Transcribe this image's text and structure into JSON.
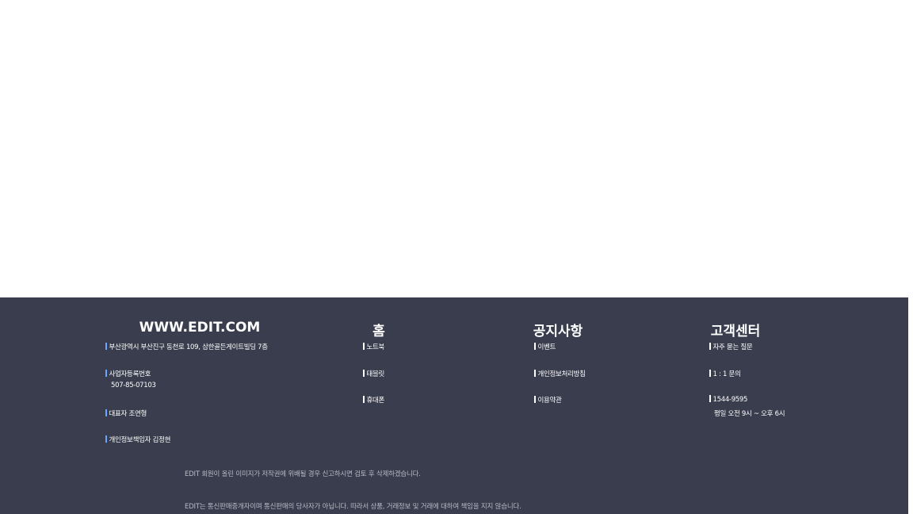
{
  "footer": {
    "col1": {
      "title": "WWW.EDIT.COM",
      "address": "부산광역시 부산진구 동천로 109, 삼한골든게이트빌딩 7층",
      "biz_label": "사업자등록번호",
      "biz_number": "507-85-07103",
      "ceo": "대표자 조연형",
      "privacy_officer": "개인정보책임자 김정현"
    },
    "col2": {
      "title": "홈",
      "items": [
        "노트북",
        "태블릿",
        "휴대폰"
      ]
    },
    "col3": {
      "title": "공지사항",
      "items": [
        "이벤트",
        "개인정보처리방침",
        "이용약관"
      ]
    },
    "col4": {
      "title": "고객센터",
      "faq": "자주 묻는 질문",
      "inquiry": "1 : 1 문의",
      "phone": "1544-9595",
      "hours": "평일 오전 9시 ~ 오후 6시"
    },
    "notice1": "EDIT 회원이 올린 이미지가 저작권에 위배될 경우 신고하시면 검토 후 삭제하겠습니다.",
    "notice2": "EDIT는 통신판매중개자이며 통신판매의 당사자가 아닙니다. 따라서 상품, 거래정보 및 거래에 대하여 책임을 지지 않습니다."
  },
  "colors": {
    "footer_bg": "#3a3d4d",
    "accent_bar": "#6aa8ff",
    "notice_text": "#b8bac4"
  }
}
